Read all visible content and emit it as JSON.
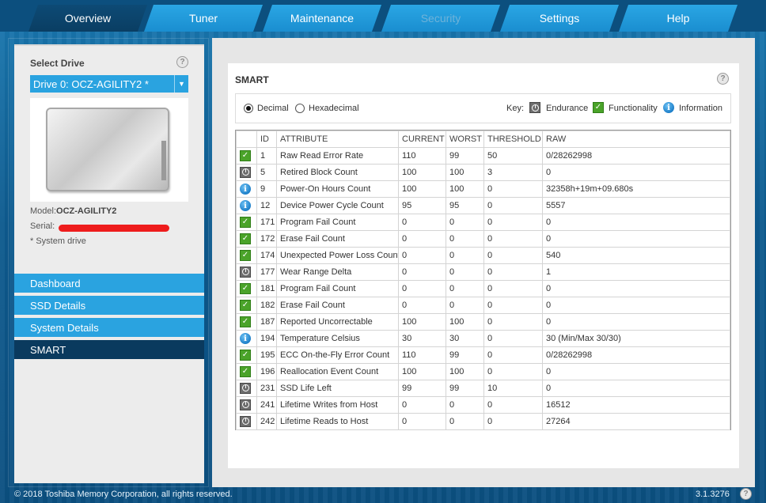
{
  "tabs": [
    {
      "label": "Overview",
      "state": "active"
    },
    {
      "label": "Tuner",
      "state": "normal"
    },
    {
      "label": "Maintenance",
      "state": "normal"
    },
    {
      "label": "Security",
      "state": "disabled"
    },
    {
      "label": "Settings",
      "state": "normal"
    },
    {
      "label": "Help",
      "state": "normal"
    }
  ],
  "sidebar": {
    "select_drive_label": "Select Drive",
    "help_glyph": "?",
    "drive_selected": "Drive 0: OCZ-AGILITY2 *",
    "dropdown_glyph": "▼",
    "model_label": "Model:",
    "model_value": "OCZ-AGILITY2",
    "serial_label": "Serial:",
    "system_drive_note": "* System drive",
    "nav": [
      {
        "label": "Dashboard",
        "active": false
      },
      {
        "label": "SSD Details",
        "active": false
      },
      {
        "label": "System Details",
        "active": false
      },
      {
        "label": "SMART",
        "active": true
      }
    ]
  },
  "smart": {
    "title": "SMART",
    "help_glyph": "?",
    "radix": {
      "decimal_label": "Decimal",
      "hex_label": "Hexadecimal",
      "selected": "decimal"
    },
    "key": {
      "label": "Key:",
      "endurance_label": "Endurance",
      "functionality_label": "Functionality",
      "information_label": "Information"
    },
    "columns": [
      "",
      "ID",
      "ATTRIBUTE",
      "CURRENT",
      "WORST",
      "THRESHOLD",
      "RAW"
    ],
    "rows": [
      {
        "icon": "functionality",
        "id": "1",
        "attribute": "Raw Read Error Rate",
        "current": "110",
        "worst": "99",
        "threshold": "50",
        "raw": "0/28262998"
      },
      {
        "icon": "endurance",
        "id": "5",
        "attribute": "Retired Block Count",
        "current": "100",
        "worst": "100",
        "threshold": "3",
        "raw": "0"
      },
      {
        "icon": "information",
        "id": "9",
        "attribute": "Power-On Hours Count",
        "current": "100",
        "worst": "100",
        "threshold": "0",
        "raw": "32358h+19m+09.680s"
      },
      {
        "icon": "information",
        "id": "12",
        "attribute": "Device Power Cycle Count",
        "current": "95",
        "worst": "95",
        "threshold": "0",
        "raw": "5557"
      },
      {
        "icon": "functionality",
        "id": "171",
        "attribute": "Program Fail Count",
        "current": "0",
        "worst": "0",
        "threshold": "0",
        "raw": "0"
      },
      {
        "icon": "functionality",
        "id": "172",
        "attribute": "Erase Fail Count",
        "current": "0",
        "worst": "0",
        "threshold": "0",
        "raw": "0"
      },
      {
        "icon": "functionality",
        "id": "174",
        "attribute": "Unexpected Power Loss Count",
        "current": "0",
        "worst": "0",
        "threshold": "0",
        "raw": "540"
      },
      {
        "icon": "endurance",
        "id": "177",
        "attribute": "Wear Range Delta",
        "current": "0",
        "worst": "0",
        "threshold": "0",
        "raw": "1"
      },
      {
        "icon": "functionality",
        "id": "181",
        "attribute": "Program Fail Count",
        "current": "0",
        "worst": "0",
        "threshold": "0",
        "raw": "0"
      },
      {
        "icon": "functionality",
        "id": "182",
        "attribute": "Erase Fail Count",
        "current": "0",
        "worst": "0",
        "threshold": "0",
        "raw": "0"
      },
      {
        "icon": "functionality",
        "id": "187",
        "attribute": "Reported Uncorrectable",
        "current": "100",
        "worst": "100",
        "threshold": "0",
        "raw": "0"
      },
      {
        "icon": "information",
        "id": "194",
        "attribute": "Temperature Celsius",
        "current": "30",
        "worst": "30",
        "threshold": "0",
        "raw": "30 (Min/Max 30/30)"
      },
      {
        "icon": "functionality",
        "id": "195",
        "attribute": "ECC On-the-Fly Error Count",
        "current": "110",
        "worst": "99",
        "threshold": "0",
        "raw": "0/28262998"
      },
      {
        "icon": "functionality",
        "id": "196",
        "attribute": "Reallocation Event Count",
        "current": "100",
        "worst": "100",
        "threshold": "0",
        "raw": "0"
      },
      {
        "icon": "endurance",
        "id": "231",
        "attribute": "SSD Life Left",
        "current": "99",
        "worst": "99",
        "threshold": "10",
        "raw": "0"
      },
      {
        "icon": "endurance",
        "id": "241",
        "attribute": "Lifetime Writes from Host",
        "current": "0",
        "worst": "0",
        "threshold": "0",
        "raw": "16512"
      },
      {
        "icon": "endurance",
        "id": "242",
        "attribute": "Lifetime Reads to Host",
        "current": "0",
        "worst": "0",
        "threshold": "0",
        "raw": "27264"
      }
    ]
  },
  "footer": {
    "copyright": "© 2018 Toshiba Memory Corporation, all rights reserved.",
    "version": "3.1.3276",
    "help_glyph": "?"
  },
  "colors": {
    "accent": "#2aa3e0",
    "active_nav": "#0a3a5e",
    "check_green": "#4aa329",
    "serial_redaction": "#ee1c1c"
  }
}
